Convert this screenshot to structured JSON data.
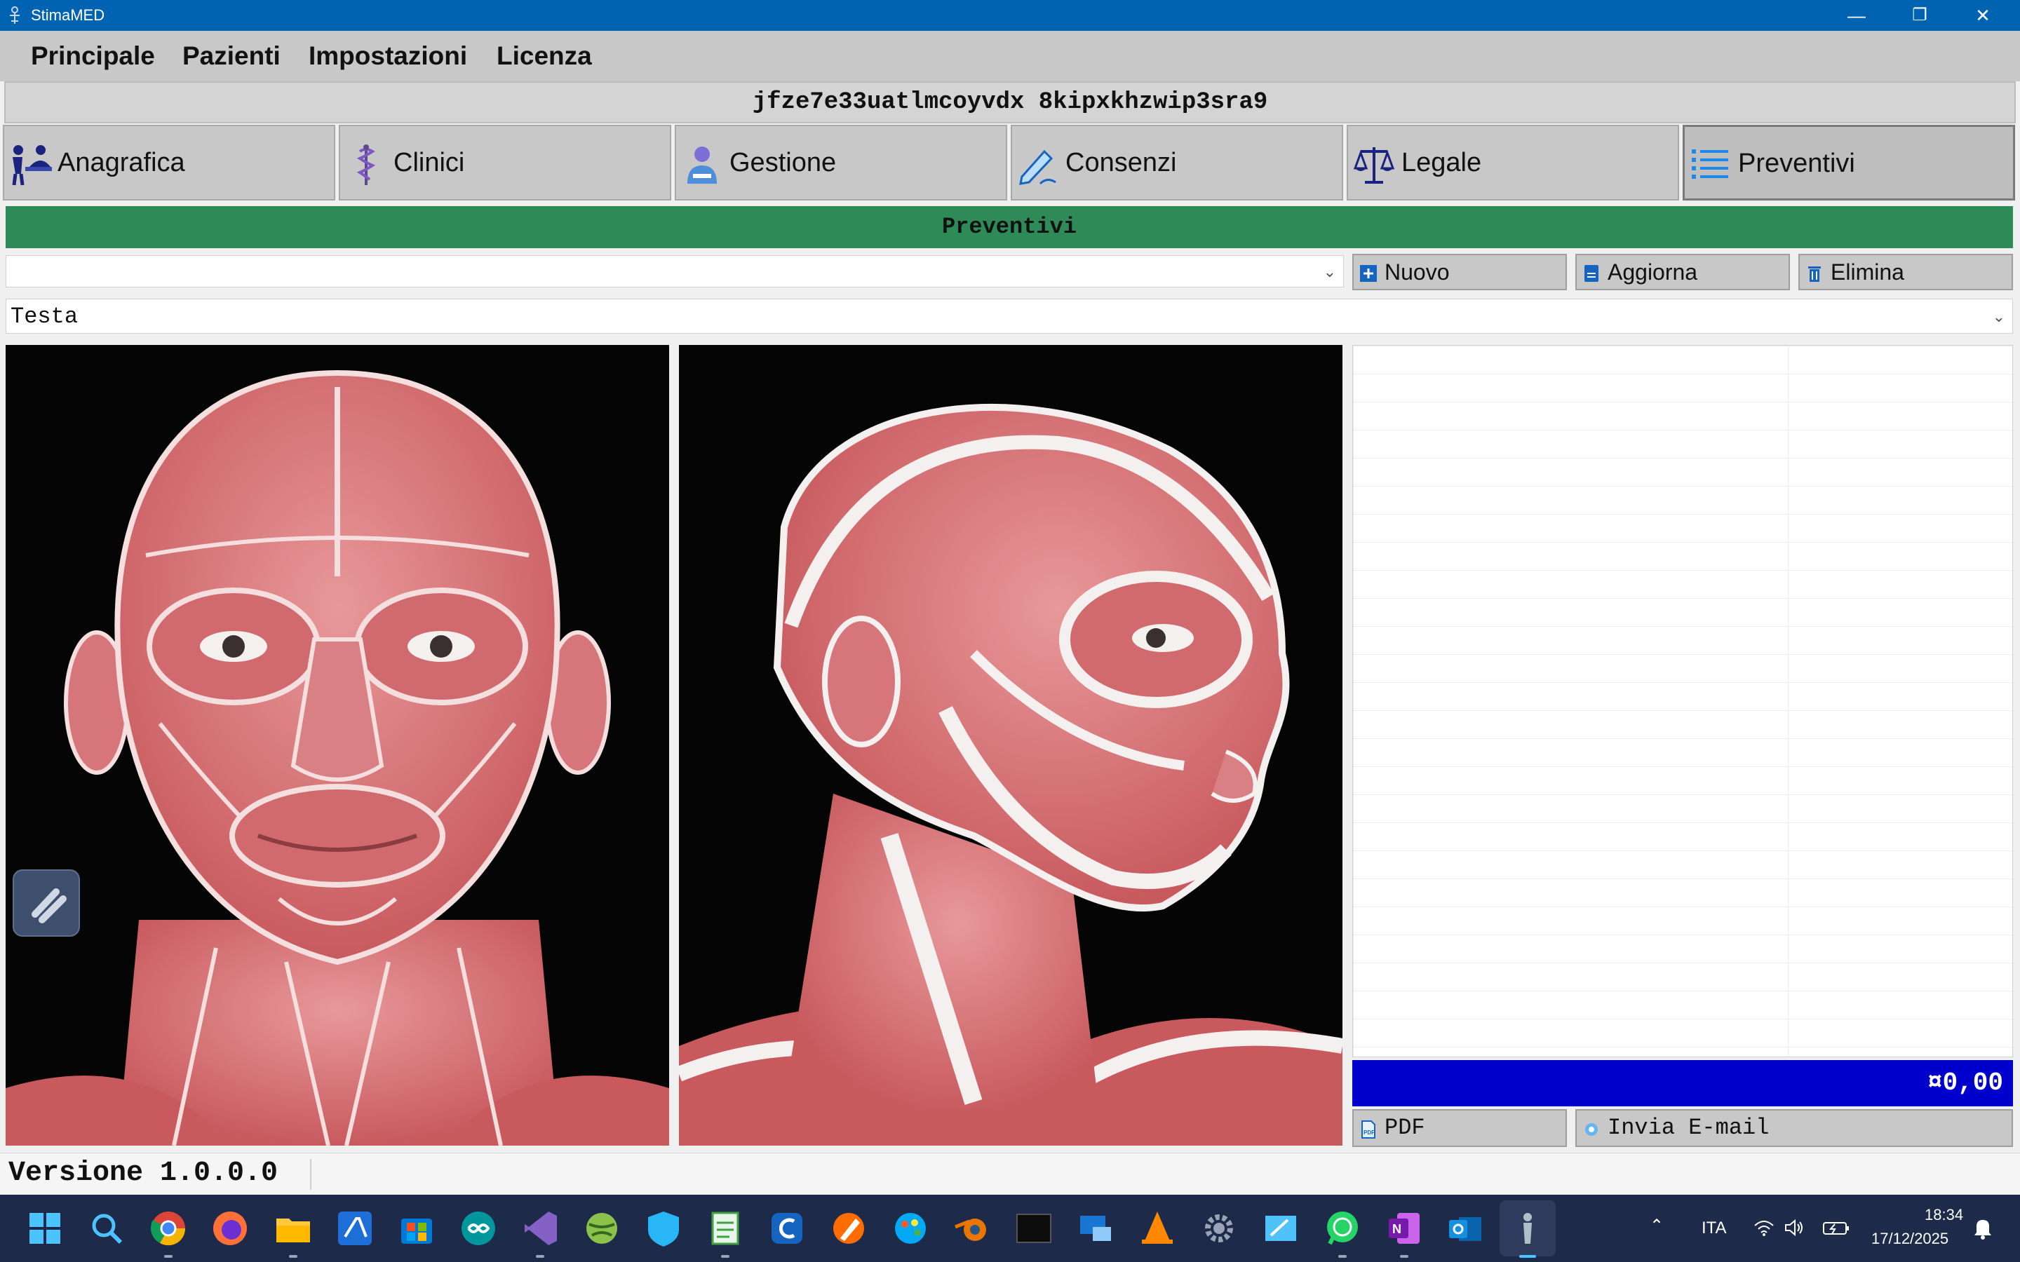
{
  "window": {
    "title": "StimaMED",
    "minimize": "—",
    "restore": "❐",
    "close": "✕"
  },
  "menu": [
    "Principale",
    "Pazienti",
    "Impostazioni",
    "Licenza"
  ],
  "record_id": "jfze7e33uatlmcoyvdx 8kipxkhzwip3sra9",
  "tabs": [
    {
      "label": "Anagrafica",
      "icon": "patient-user-icon"
    },
    {
      "label": "Clinici",
      "icon": "caduceus-icon"
    },
    {
      "label": "Gestione",
      "icon": "doctor-icon"
    },
    {
      "label": "Consenzi",
      "icon": "signature-pen-icon"
    },
    {
      "label": "Legale",
      "icon": "scales-icon"
    },
    {
      "label": "Preventivi",
      "icon": "list-icon"
    }
  ],
  "section_title": "Preventivi",
  "quote_select": {
    "value": ""
  },
  "actions": {
    "new": "Nuovo",
    "update": "Aggiorna",
    "delete": "Elimina"
  },
  "region_select": {
    "value": "Testa"
  },
  "total": "¤0,00",
  "footer_buttons": {
    "pdf": "PDF",
    "email": "Invia E-mail"
  },
  "status": {
    "version": "Versione 1.0.0.0"
  },
  "tray": {
    "language": "ITA",
    "time": "18:34",
    "date": "17/12/2025"
  },
  "colors": {
    "titlebar": "#0063b1",
    "section": "#2e8b57",
    "total": "#0000cd",
    "taskbar": "#1d2a4a"
  }
}
